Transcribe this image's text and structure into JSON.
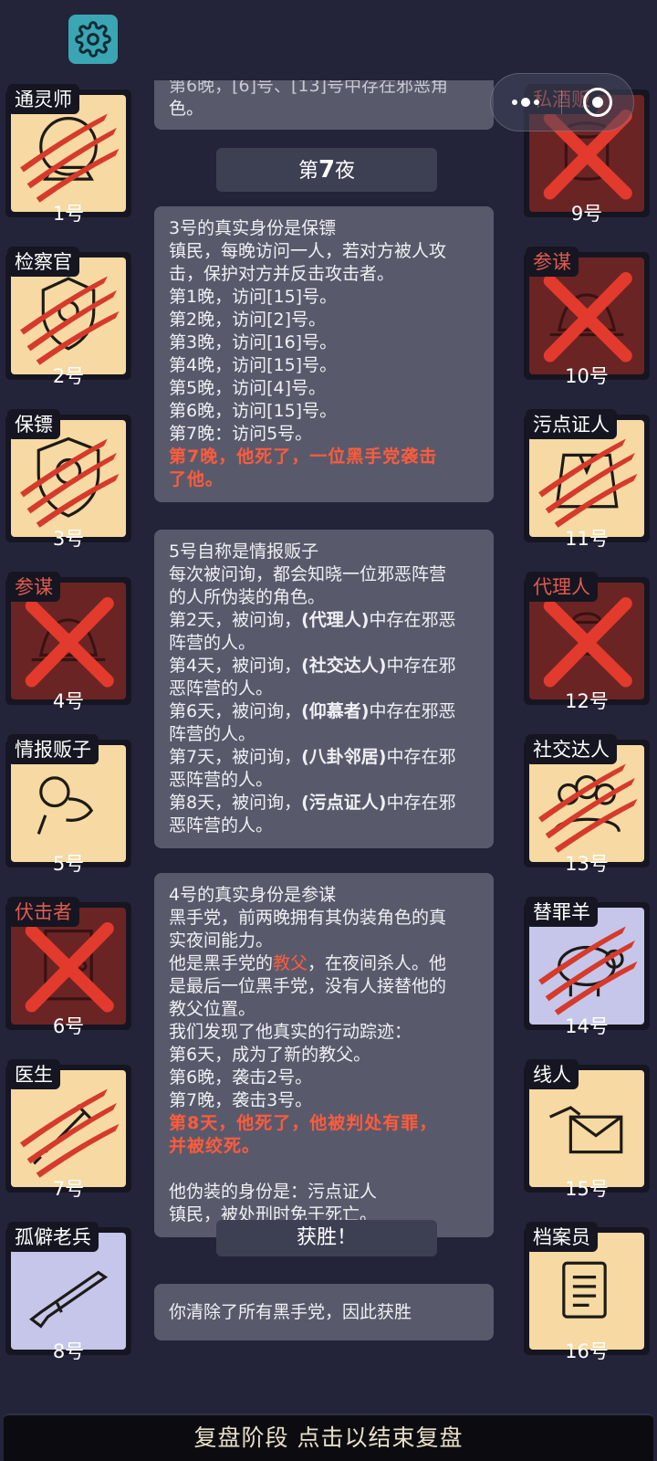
{
  "settings_icon": "gear-icon",
  "capsule": {
    "menu_icon": "more-dots-icon",
    "close_icon": "target-close-icon"
  },
  "players_left": [
    {
      "role": "通灵师",
      "num": "1号",
      "card": "town",
      "dead": "scratch",
      "icon": "crystal-ball-icon",
      "role_color": "white"
    },
    {
      "role": "检察官",
      "num": "2号",
      "card": "town",
      "dead": "scratch",
      "icon": "badge-icon",
      "role_color": "white"
    },
    {
      "role": "保镖",
      "num": "3号",
      "card": "town",
      "dead": "scratch",
      "icon": "shield-icon",
      "role_color": "white"
    },
    {
      "role": "参谋",
      "num": "4号",
      "card": "maf",
      "dead": "cross",
      "icon": "hat-icon",
      "role_color": "red"
    },
    {
      "role": "情报贩子",
      "num": "5号",
      "card": "town",
      "dead": "none",
      "icon": "whisper-icon",
      "role_color": "white"
    },
    {
      "role": "伏击者",
      "num": "6号",
      "card": "maf",
      "dead": "cross",
      "icon": "door-icon",
      "role_color": "red"
    },
    {
      "role": "医生",
      "num": "7号",
      "card": "town",
      "dead": "scratch",
      "icon": "syringe-icon",
      "role_color": "white"
    },
    {
      "role": "孤僻老兵",
      "num": "8号",
      "card": "neutral",
      "dead": "none",
      "icon": "rifle-icon",
      "role_color": "white"
    }
  ],
  "players_right": [
    {
      "role": "私酒贩",
      "num": "9号",
      "card": "maf",
      "dead": "cross",
      "icon": "barrel-icon",
      "role_color": "red"
    },
    {
      "role": "参谋",
      "num": "10号",
      "card": "maf",
      "dead": "cross",
      "icon": "hat-icon",
      "role_color": "red"
    },
    {
      "role": "污点证人",
      "num": "11号",
      "card": "town",
      "dead": "scratch",
      "icon": "suit-icon",
      "role_color": "white"
    },
    {
      "role": "代理人",
      "num": "12号",
      "card": "maf",
      "dead": "cross",
      "icon": "agent-icon",
      "role_color": "red"
    },
    {
      "role": "社交达人",
      "num": "13号",
      "card": "town",
      "dead": "scratch",
      "icon": "crowd-icon",
      "role_color": "white"
    },
    {
      "role": "替罪羊",
      "num": "14号",
      "card": "neutral",
      "dead": "scratch",
      "icon": "sheep-icon",
      "role_color": "white"
    },
    {
      "role": "线人",
      "num": "15号",
      "card": "town",
      "dead": "none",
      "icon": "letter-icon",
      "role_color": "white"
    },
    {
      "role": "档案员",
      "num": "16号",
      "card": "town",
      "dead": "none",
      "icon": "documents-icon",
      "role_color": "white"
    }
  ],
  "feed": {
    "top_partial": [
      "第6晚，[6]号、[13]号中存在邪恶角",
      "色。"
    ],
    "night_header_prefix": "第",
    "night_header_num": "7",
    "night_header_suffix": "夜",
    "msg1": {
      "lines": [
        "3号的真实身份是保镖",
        "镇民，每晚访问一人，若对方被人攻",
        "击，保护对方并反击攻击者。",
        "第1晚，访问[15]号。",
        "第2晚，访问[2]号。",
        "第3晚，访问[16]号。",
        "第4晚，访问[15]号。",
        "第5晚，访问[4]号。",
        "第6晚，访问[15]号。",
        "第7晚：访问5号。"
      ],
      "red_lines": [
        "第7晚，他死了，一位黑手党袭击",
        "了他。"
      ]
    },
    "msg2": {
      "l1": "5号自称是情报贩子",
      "l2": "每次被问询，都会知晓一位邪恶阵营",
      "l3": "的人所伪装的角色。",
      "d2a": "第2天，被问询，",
      "d2r": "(代理人)",
      "d2b": "中存在邪恶",
      "d2c": "阵营的人。",
      "d4a": "第4天，被问询，",
      "d4r": "(社交达人)",
      "d4b": "中存在邪",
      "d4c": "恶阵营的人。",
      "d6a": "第6天，被问询，",
      "d6r": "(仰慕者)",
      "d6b": "中存在邪恶",
      "d6c": "阵营的人。",
      "d7a": "第7天，被问询，",
      "d7r": "(八卦邻居)",
      "d7b": "中存在邪",
      "d7c": "恶阵营的人。",
      "d8a": "第8天，被问询，",
      "d8r": "(污点证人)",
      "d8b": "中存在邪",
      "d8c": "恶阵营的人。"
    },
    "msg3": {
      "l1": "4号的真实身份是参谋",
      "l2": "黑手党，前两晚拥有其伪装角色的真",
      "l3": "实夜间能力。",
      "l4a": "他是黑手党的",
      "l4r": "教父",
      "l4b": "，在夜间杀人。他",
      "l5": "是最后一位黑手党，没有人接替他的",
      "l6": "教父位置。",
      "l7": "我们发现了他真实的行动踪迹：",
      "l8": "第6天，成为了新的教父。",
      "l9": "第6晚，袭击2号。",
      "l10": "第7晚，袭击3号。",
      "r1": "第8天，他死了，他被判处有罪，",
      "r2": "并被绞死。",
      "l11": "他伪装的身份是：污点证人",
      "l12": "镇民，被处刑时免于死亡。"
    },
    "win_header": "获胜！",
    "win_msg": "你清除了所有黑手党，因此获胜"
  },
  "bottom_bar": "复盘阶段 点击以结束复盘",
  "colors": {
    "bg": "#23243a",
    "town_card": "#f6d9a3",
    "mafia_card": "#6b2424",
    "neutral_card": "#c5c6ea",
    "red_text": "#ff5b3b",
    "accent": "#3aa6b4"
  }
}
